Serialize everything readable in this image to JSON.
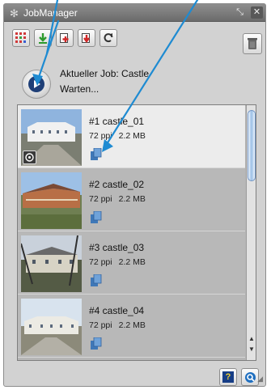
{
  "window": {
    "title": "JobManager",
    "title_icon": "gear-icon"
  },
  "status": {
    "job_line": "Aktueller Job: Castle",
    "state_line": "Warten..."
  },
  "jobs": [
    {
      "name": "#1 castle_01",
      "ppi": "72 ppi",
      "size": "2.2 MB",
      "selected": true
    },
    {
      "name": "#2 castle_02",
      "ppi": "72 ppi",
      "size": "2.2 MB",
      "selected": false
    },
    {
      "name": "#3 castle_03",
      "ppi": "72 ppi",
      "size": "2.2 MB",
      "selected": false
    },
    {
      "name": "#4 castle_04",
      "ppi": "72 ppi",
      "size": "2.2 MB",
      "selected": false
    }
  ],
  "help": {
    "label": "?"
  },
  "colors": {
    "accent": "#1f7fc4",
    "panel": "#d2d2d2",
    "selected_row": "#ececec",
    "row": "#b8b8b8"
  }
}
